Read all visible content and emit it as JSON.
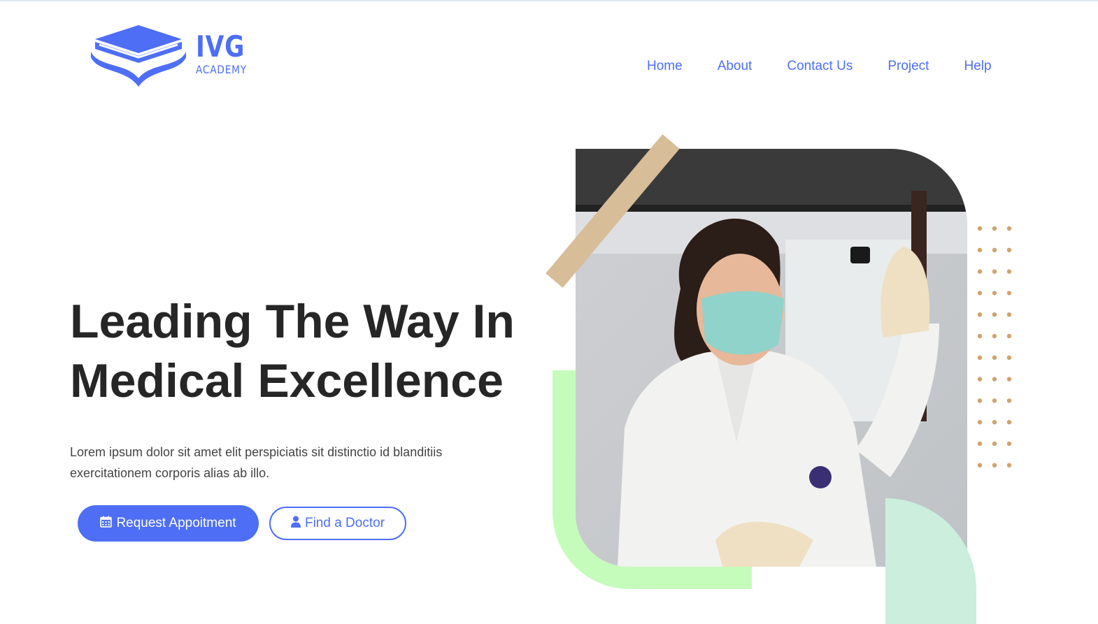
{
  "brand": {
    "name": "IVG",
    "subtitle": "ACADEMY",
    "color": "#4d6ef5"
  },
  "nav": {
    "items": [
      {
        "label": "Home"
      },
      {
        "label": "About"
      },
      {
        "label": "Contact Us"
      },
      {
        "label": "Project"
      },
      {
        "label": "Help"
      }
    ]
  },
  "hero": {
    "title_line1": "Leading The Way In",
    "title_line2": "Medical Excellence",
    "description_line1": "Lorem ipsum dolor sit amet elit perspiciatis sit distinctio id blanditiis",
    "description_line2": "exercitationem corporis alias ab illo.",
    "primary_button": {
      "label": "Request Appoitment",
      "icon": "calendar-icon"
    },
    "secondary_button": {
      "label": "Find a Doctor",
      "icon": "user-icon"
    }
  },
  "colors": {
    "accent": "#4d6ef5",
    "heading": "#262626",
    "green_shape": "#c5fcbb",
    "tan_bar": "#d7bd98",
    "mint_shape": "#cbeedd",
    "dots": "#d1a36d"
  }
}
